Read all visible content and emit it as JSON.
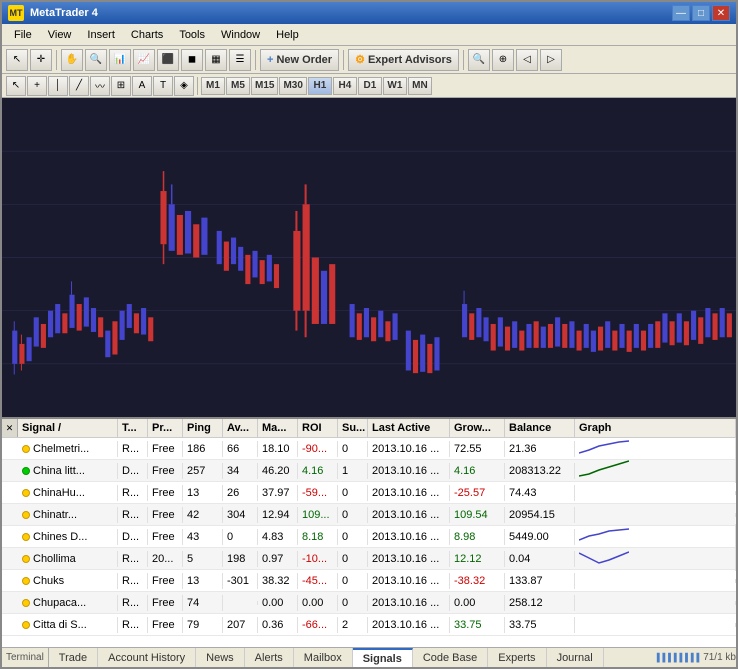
{
  "window": {
    "title": "MetaTrader 4",
    "icon": "MT"
  },
  "title_buttons": {
    "minimize": "—",
    "maximize": "□",
    "close": "✕"
  },
  "menu": {
    "items": [
      "File",
      "View",
      "Insert",
      "Charts",
      "Tools",
      "Window",
      "Help"
    ]
  },
  "toolbar1": {
    "new_order_label": "New Order",
    "expert_advisors_label": "Expert Advisors"
  },
  "toolbar2": {
    "timeframes": [
      "M1",
      "M5",
      "M15",
      "M30",
      "H1",
      "H4",
      "D1",
      "W1",
      "MN"
    ]
  },
  "signals_table": {
    "headers": {
      "signal": "Signal",
      "t": "T...",
      "pr": "Pr...",
      "ping": "Ping",
      "av": "Av...",
      "ma": "Ma...",
      "roi": "ROI",
      "su": "Su...",
      "last_active": "Last Active",
      "grow": "Grow...",
      "balance": "Balance",
      "graph": "Graph"
    },
    "sort_indicator": "/",
    "rows": [
      {
        "dot": "yellow",
        "signal": "Chelmetri...",
        "t": "R...",
        "pr": "Free",
        "ping": "186",
        "av": "66",
        "ma": "18.10",
        "roi": "-90...",
        "su": "0",
        "last_active": "2013.10.16 ...",
        "grow": "72.55",
        "balance": "21.36",
        "has_graph": true,
        "graph_trend": "up"
      },
      {
        "dot": "green",
        "signal": "China litt...",
        "t": "D...",
        "pr": "Free",
        "ping": "257",
        "av": "34",
        "ma": "46.20",
        "roi": "4.16",
        "su": "1",
        "last_active": "2013.10.16 ...",
        "grow": "4.16",
        "balance": "208313.22",
        "has_graph": true,
        "graph_trend": "up_strong"
      },
      {
        "dot": "yellow",
        "signal": "ChinaHu...",
        "t": "R...",
        "pr": "Free",
        "ping": "13",
        "av": "26",
        "ma": "37.97",
        "roi": "-59...",
        "su": "0",
        "last_active": "2013.10.16 ...",
        "grow": "-25.57",
        "balance": "74.43",
        "has_graph": false,
        "graph_trend": "flat"
      },
      {
        "dot": "yellow",
        "signal": "Chinatr...",
        "t": "R...",
        "pr": "Free",
        "ping": "42",
        "av": "304",
        "ma": "12.94",
        "roi": "109...",
        "su": "0",
        "last_active": "2013.10.16 ...",
        "grow": "109.54",
        "balance": "20954.15",
        "has_graph": false,
        "graph_trend": "flat"
      },
      {
        "dot": "yellow",
        "signal": "Chines D...",
        "t": "D...",
        "pr": "Free",
        "ping": "43",
        "av": "0",
        "ma": "4.83",
        "roi": "8.18",
        "su": "0",
        "last_active": "2013.10.16 ...",
        "grow": "8.98",
        "balance": "5449.00",
        "has_graph": true,
        "graph_trend": "up"
      },
      {
        "dot": "yellow",
        "signal": "Chollima",
        "t": "R...",
        "pr": "20...",
        "ping": "5",
        "av": "198",
        "ma": "0.97",
        "roi": "-10...",
        "su": "0",
        "last_active": "2013.10.16 ...",
        "grow": "12.12",
        "balance": "0.04",
        "has_graph": true,
        "graph_trend": "down_up"
      },
      {
        "dot": "yellow",
        "signal": "Chuks",
        "t": "R...",
        "pr": "Free",
        "ping": "13",
        "av": "-301",
        "ma": "38.32",
        "roi": "-45...",
        "su": "0",
        "last_active": "2013.10.16 ...",
        "grow": "-38.32",
        "balance": "133.87",
        "has_graph": false,
        "graph_trend": "flat"
      },
      {
        "dot": "yellow",
        "signal": "Chupaca...",
        "t": "R...",
        "pr": "Free",
        "ping": "74",
        "av": "",
        "ma": "0.00",
        "roi": "0.00",
        "su": "0",
        "last_active": "2013.10.16 ...",
        "grow": "0.00",
        "balance": "258.12",
        "has_graph": false,
        "graph_trend": "flat"
      },
      {
        "dot": "yellow",
        "signal": "Citta di S...",
        "t": "R...",
        "pr": "Free",
        "ping": "79",
        "av": "207",
        "ma": "0.36",
        "roi": "-66...",
        "su": "2",
        "last_active": "2013.10.16 ...",
        "grow": "33.75",
        "balance": "33.75",
        "has_graph": false,
        "graph_trend": "flat"
      }
    ]
  },
  "tabs": {
    "items": [
      "Trade",
      "Account History",
      "News",
      "Alerts",
      "Mailbox",
      "Signals",
      "Code Base",
      "Experts",
      "Journal"
    ],
    "active": "Signals"
  },
  "status": {
    "bars": "▐▐▐▐▐▐▐▐",
    "size": "71/1 kb"
  }
}
